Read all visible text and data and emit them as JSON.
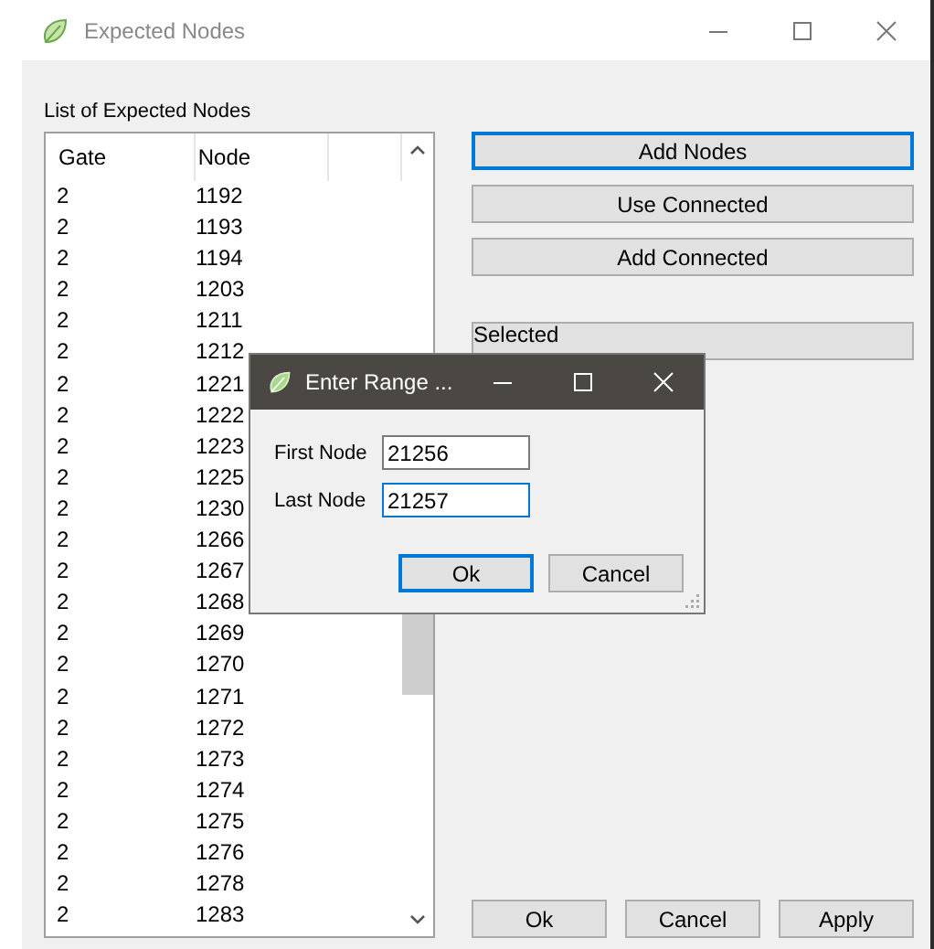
{
  "window": {
    "title": "Expected Nodes"
  },
  "list": {
    "label": "List of Expected Nodes",
    "columns": [
      "Gate",
      "Node"
    ],
    "rows": [
      [
        "2",
        "1192"
      ],
      [
        "2",
        "1193"
      ],
      [
        "2",
        "1194"
      ],
      [
        "2",
        "1203"
      ],
      [
        "2",
        "1211"
      ],
      [
        "2",
        "1212"
      ],
      [
        "2",
        "1221"
      ],
      [
        "2",
        "1222"
      ],
      [
        "2",
        "1223"
      ],
      [
        "2",
        "1225"
      ],
      [
        "2",
        "1230"
      ],
      [
        "2",
        "1266"
      ],
      [
        "2",
        "1267"
      ],
      [
        "2",
        "1268"
      ],
      [
        "2",
        "1269"
      ],
      [
        "2",
        "1270"
      ],
      [
        "2",
        "1271"
      ],
      [
        "2",
        "1272"
      ],
      [
        "2",
        "1273"
      ],
      [
        "2",
        "1274"
      ],
      [
        "2",
        "1275"
      ],
      [
        "2",
        "1276"
      ],
      [
        "2",
        "1278"
      ],
      [
        "2",
        "1283"
      ]
    ]
  },
  "side_buttons": [
    {
      "label": "Add Nodes",
      "focused": true
    },
    {
      "label": "Use Connected",
      "focused": false
    },
    {
      "label": "Add Connected",
      "focused": false
    },
    {
      "label": "Selected",
      "focused": false
    }
  ],
  "bottom_buttons": [
    {
      "label": "Ok",
      "focused": false
    },
    {
      "label": "Cancel",
      "focused": false
    },
    {
      "label": "Apply",
      "focused": false
    }
  ],
  "dialog": {
    "title": "Enter Range ...",
    "fields": [
      {
        "label": "First Node",
        "value": "21256",
        "focused": false
      },
      {
        "label": "Last Node",
        "value": "21257",
        "focused": true
      }
    ],
    "buttons": [
      {
        "label": "Ok",
        "focused": true
      },
      {
        "label": "Cancel",
        "focused": false
      }
    ]
  }
}
